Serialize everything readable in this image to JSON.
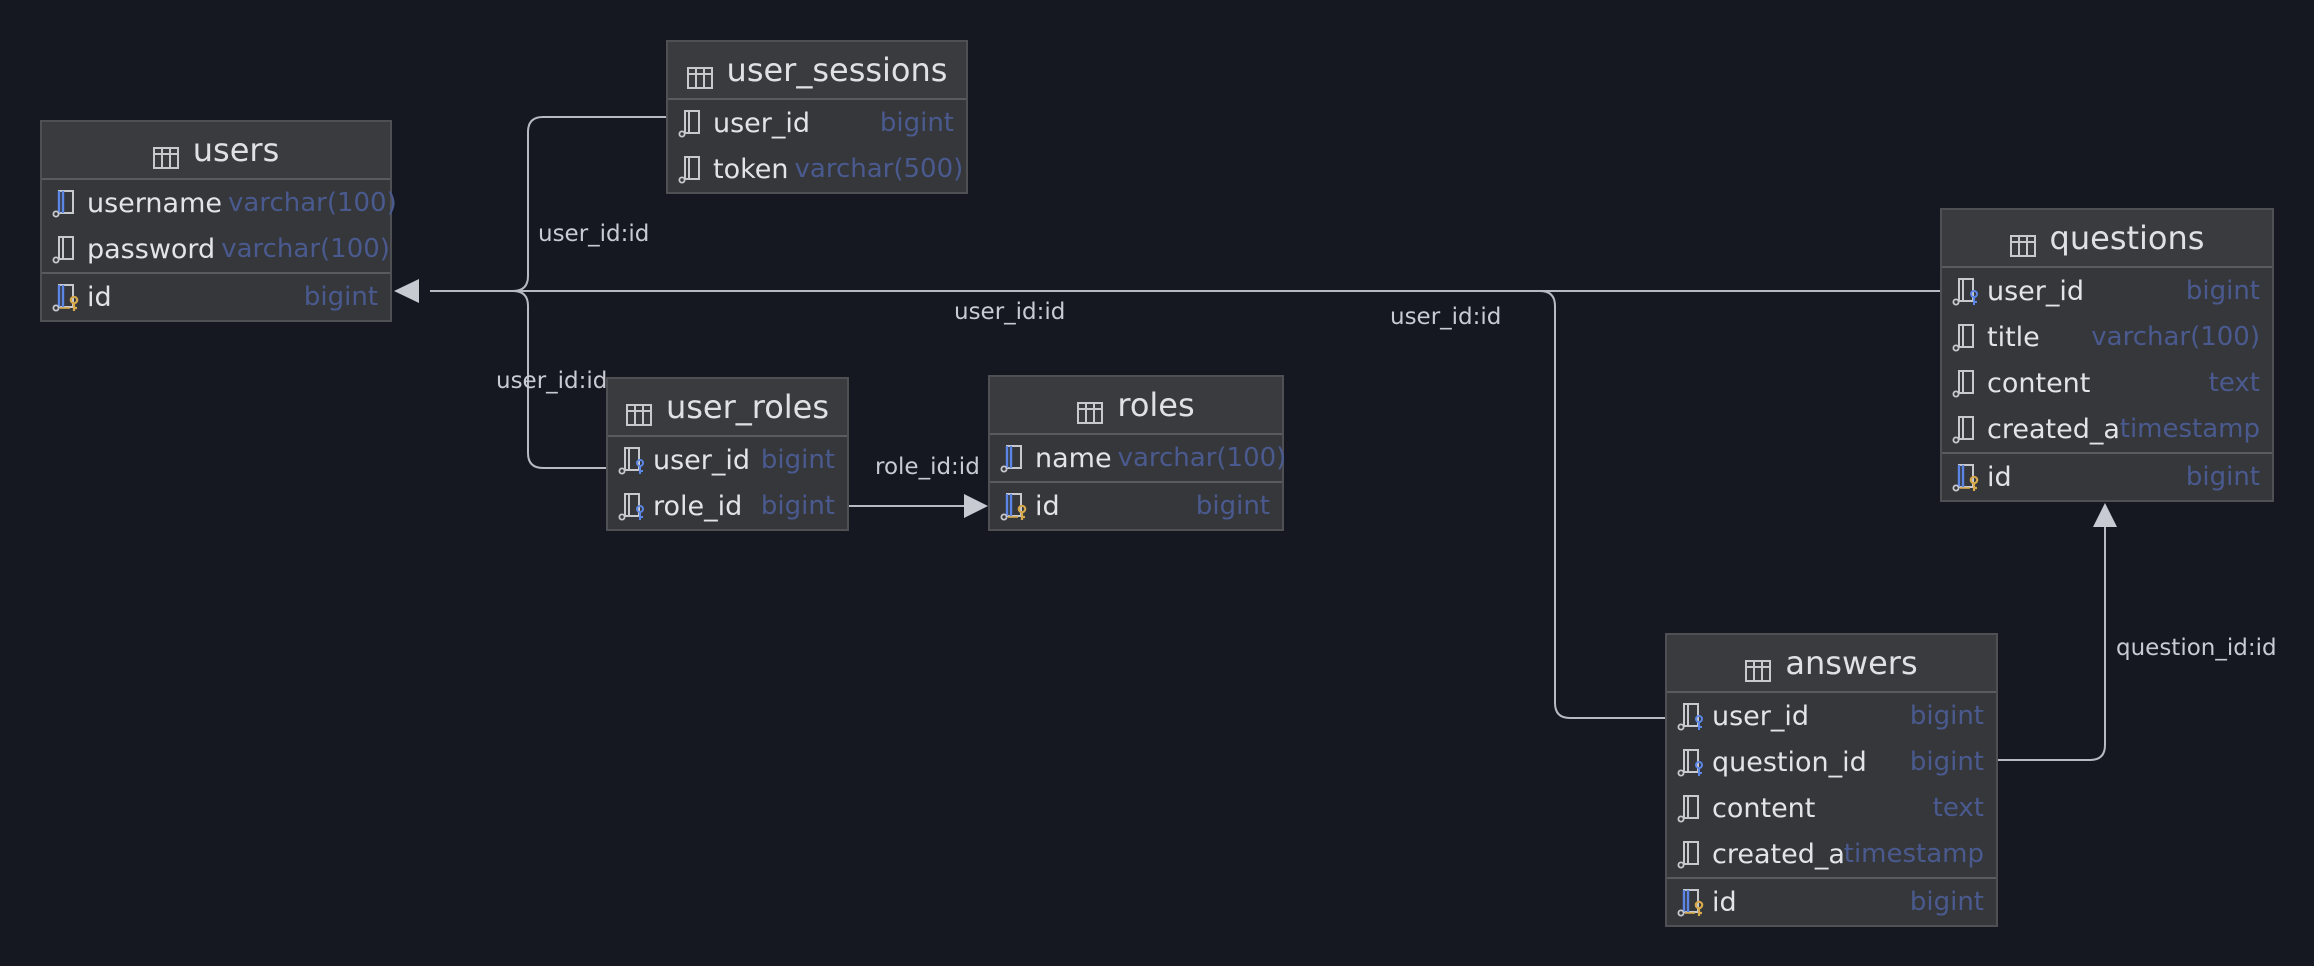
{
  "tables": {
    "users": {
      "name": "users",
      "columns": [
        {
          "name": "username",
          "type": "varchar(100)",
          "icon": "indexed-column-icon"
        },
        {
          "name": "password",
          "type": "varchar(100)",
          "icon": "column-icon"
        },
        {
          "name": "id",
          "type": "bigint",
          "icon": "primary-key-icon"
        }
      ]
    },
    "user_sessions": {
      "name": "user_sessions",
      "columns": [
        {
          "name": "user_id",
          "type": "bigint",
          "icon": "column-icon"
        },
        {
          "name": "token",
          "type": "varchar(500)",
          "icon": "column-icon"
        }
      ]
    },
    "user_roles": {
      "name": "user_roles",
      "columns": [
        {
          "name": "user_id",
          "type": "bigint",
          "icon": "foreign-key-icon"
        },
        {
          "name": "role_id",
          "type": "bigint",
          "icon": "foreign-key-icon"
        }
      ]
    },
    "roles": {
      "name": "roles",
      "columns": [
        {
          "name": "name",
          "type": "varchar(100)",
          "icon": "indexed-column-icon"
        },
        {
          "name": "id",
          "type": "bigint",
          "icon": "primary-key-icon"
        }
      ]
    },
    "questions": {
      "name": "questions",
      "columns": [
        {
          "name": "user_id",
          "type": "bigint",
          "icon": "foreign-key-icon"
        },
        {
          "name": "title",
          "type": "varchar(100)",
          "icon": "column-icon"
        },
        {
          "name": "content",
          "type": "text",
          "icon": "column-icon"
        },
        {
          "name": "created_at",
          "type": "timestamp",
          "icon": "column-icon"
        },
        {
          "name": "id",
          "type": "bigint",
          "icon": "primary-key-icon"
        }
      ]
    },
    "answers": {
      "name": "answers",
      "columns": [
        {
          "name": "user_id",
          "type": "bigint",
          "icon": "foreign-key-icon"
        },
        {
          "name": "question_id",
          "type": "bigint",
          "icon": "foreign-key-icon"
        },
        {
          "name": "content",
          "type": "text",
          "icon": "column-icon"
        },
        {
          "name": "created_at",
          "type": "timestamp",
          "icon": "column-icon"
        },
        {
          "name": "id",
          "type": "bigint",
          "icon": "primary-key-icon"
        }
      ]
    }
  },
  "relationships": [
    {
      "from": "user_sessions.user_id",
      "to": "users.id",
      "label": "user_id:id"
    },
    {
      "from": "user_roles.user_id",
      "to": "users.id",
      "label": "user_id:id"
    },
    {
      "from": "questions.user_id",
      "to": "users.id",
      "label": "user_id:id"
    },
    {
      "from": "answers.user_id",
      "to": "users.id",
      "label": "user_id:id"
    },
    {
      "from": "user_roles.role_id",
      "to": "roles.id",
      "label": "role_id:id"
    },
    {
      "from": "answers.question_id",
      "to": "questions.id",
      "label": "question_id:id"
    }
  ],
  "colors": {
    "background": "#151821",
    "table_fill": "#35373a",
    "type_text": "#4a5a8f",
    "key_gold": "#d7a94b",
    "fk_blue": "#5b86e5"
  }
}
